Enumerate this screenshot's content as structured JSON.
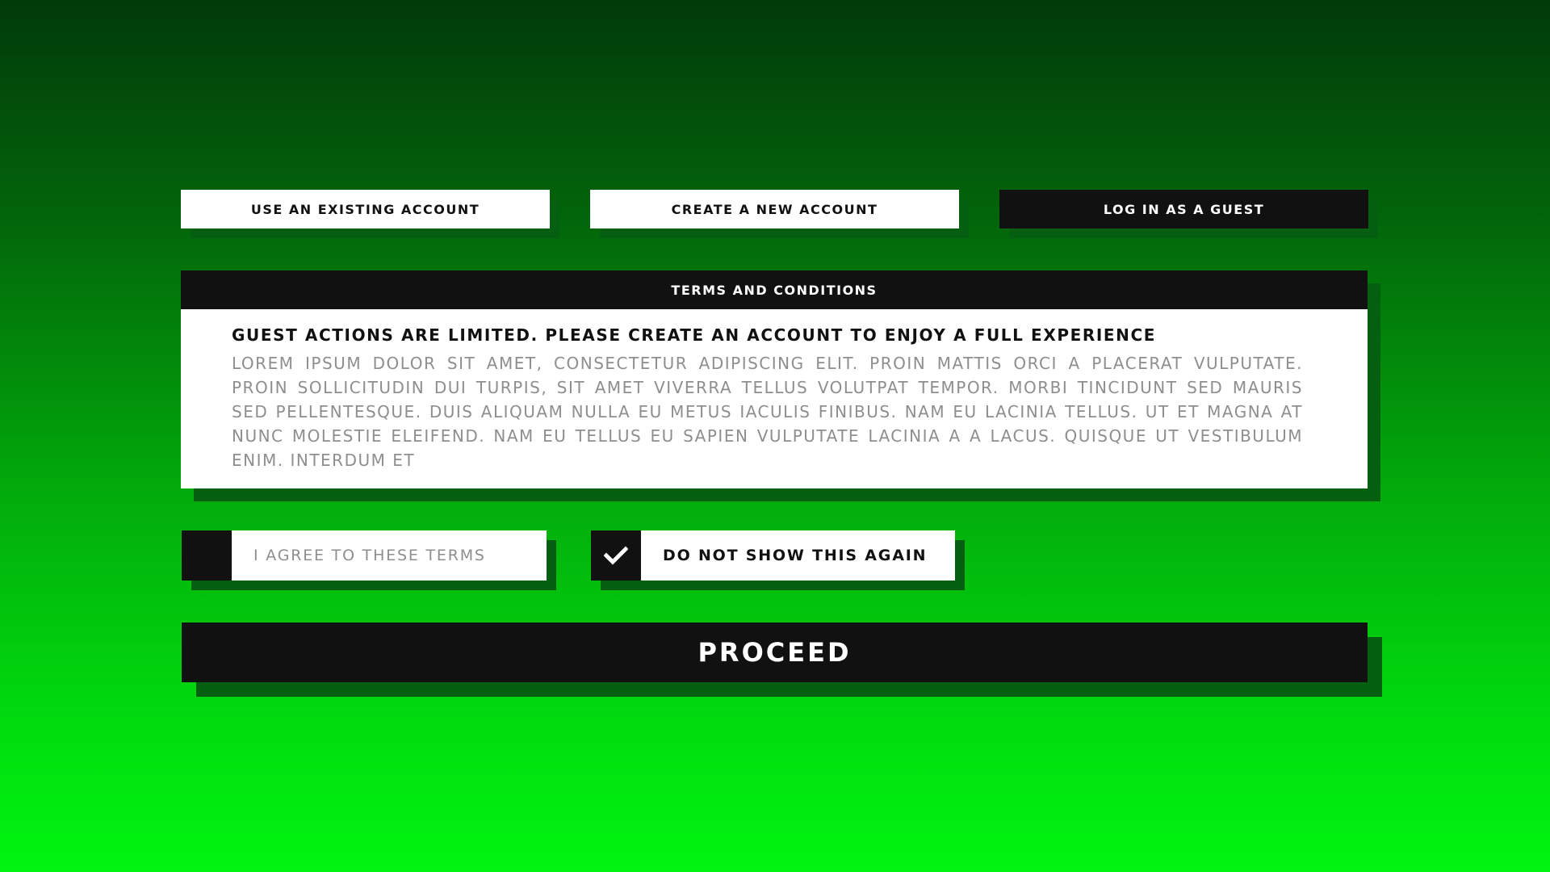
{
  "account_options": {
    "existing_label": "USE AN EXISTING ACCOUNT",
    "create_label": "CREATE A NEW ACCOUNT",
    "guest_label": "LOG IN AS A GUEST",
    "selected": "guest"
  },
  "terms": {
    "title": "TERMS AND CONDITIONS",
    "notice": "GUEST ACTIONS ARE LIMITED. PLEASE CREATE AN ACCOUNT TO ENJOY A FULL EXPERIENCE",
    "body": "LOREM IPSUM DOLOR SIT AMET, CONSECTETUR ADIPISCING ELIT. PROIN MATTIS ORCI A PLACERAT VULPUTATE. PROIN SOLLICITUDIN DUI TURPIS, SIT AMET VIVERRA TELLUS VOLUTPAT TEMPOR. MORBI TINCIDUNT SED MAURIS SED PELLENTESQUE. DUIS ALIQUAM NULLA EU METUS IACULIS FINIBUS. NAM EU LACINIA TELLUS. UT ET MAGNA AT NUNC MOLESTIE ELEIFEND. NAM EU TELLUS EU SAPIEN VULPUTATE LACINIA A A LACUS. QUISQUE UT VESTIBULUM ENIM. INTERDUM ET"
  },
  "checkboxes": {
    "agree": {
      "label": "I AGREE TO THESE TERMS",
      "checked": false
    },
    "no_show": {
      "label": "DO NOT SHOW THIS AGAIN",
      "checked": true,
      "icon": "checkmark-icon"
    }
  },
  "proceed_label": "PROCEED",
  "colors": {
    "panel_dark": "#111111",
    "panel_light": "#ffffff",
    "muted_text": "#8e8e8e",
    "shadow": "#055f10",
    "background_top": "#013a0a",
    "background_bottom": "#00f511"
  }
}
